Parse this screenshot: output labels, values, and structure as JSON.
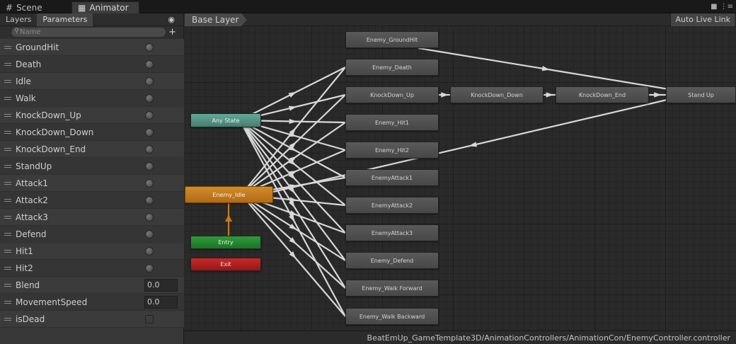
{
  "tabs": [
    {
      "label": "Scene",
      "icon": "grid-icon"
    },
    {
      "label": "Animator",
      "icon": "animator-icon"
    }
  ],
  "window_controls": {
    "lock": "🔒",
    "menu": "⋮≡"
  },
  "left_panel": {
    "subtabs": [
      "Layers",
      "Parameters"
    ],
    "active_subtab": "Parameters",
    "search_placeholder": "Name",
    "add_label": "+",
    "parameters": [
      {
        "name": "GroundHit",
        "type": "trigger"
      },
      {
        "name": "Death",
        "type": "trigger"
      },
      {
        "name": "Idle",
        "type": "trigger"
      },
      {
        "name": "Walk",
        "type": "trigger"
      },
      {
        "name": "KnockDown_Up",
        "type": "trigger"
      },
      {
        "name": "KnockDown_Down",
        "type": "trigger"
      },
      {
        "name": "KnockDown_End",
        "type": "trigger"
      },
      {
        "name": "StandUp",
        "type": "trigger"
      },
      {
        "name": "Attack1",
        "type": "trigger"
      },
      {
        "name": "Attack2",
        "type": "trigger"
      },
      {
        "name": "Attack3",
        "type": "trigger"
      },
      {
        "name": "Defend",
        "type": "trigger"
      },
      {
        "name": "Hit1",
        "type": "trigger"
      },
      {
        "name": "Hit2",
        "type": "trigger"
      },
      {
        "name": "Blend",
        "type": "float",
        "value": "0.0"
      },
      {
        "name": "MovementSpeed",
        "type": "float",
        "value": "0.0"
      },
      {
        "name": "isDead",
        "type": "bool"
      }
    ]
  },
  "graph": {
    "breadcrumb": "Base Layer",
    "live_link": "Auto Live Link",
    "status_path": "BeatEmUp_GameTemplate3D/AnimationControllers/AnimationCon/EnemyController.controller",
    "states": {
      "ground_hit": "Enemy_GroundHit",
      "death": "Enemy_Death",
      "knockdown_up": "KnockDown_Up",
      "knockdown_down": "KnockDown_Down",
      "knockdown_end": "KnockDown_End",
      "stand_up": "Stand Up",
      "hit1": "Enemy_Hit1",
      "hit2": "Enemy_Hit2",
      "attack1": "EnemyAttack1",
      "attack2": "EnemyAttack2",
      "attack3": "EnemyAttack3",
      "defend": "Enemy_Defend",
      "walk_forward": "Enemy_Walk Forward",
      "walk_backward": "Enemy_Walk Backward",
      "any_state": "Any State",
      "idle": "Enemy_Idle",
      "entry": "Entry",
      "exit": "Exit"
    },
    "colors": {
      "any_state": "#54917f",
      "default_state": "#c47a1f",
      "entry": "#25862f",
      "exit": "#b01f1f",
      "state": "#4e4e4e",
      "transition": "#d8d8d8"
    }
  }
}
